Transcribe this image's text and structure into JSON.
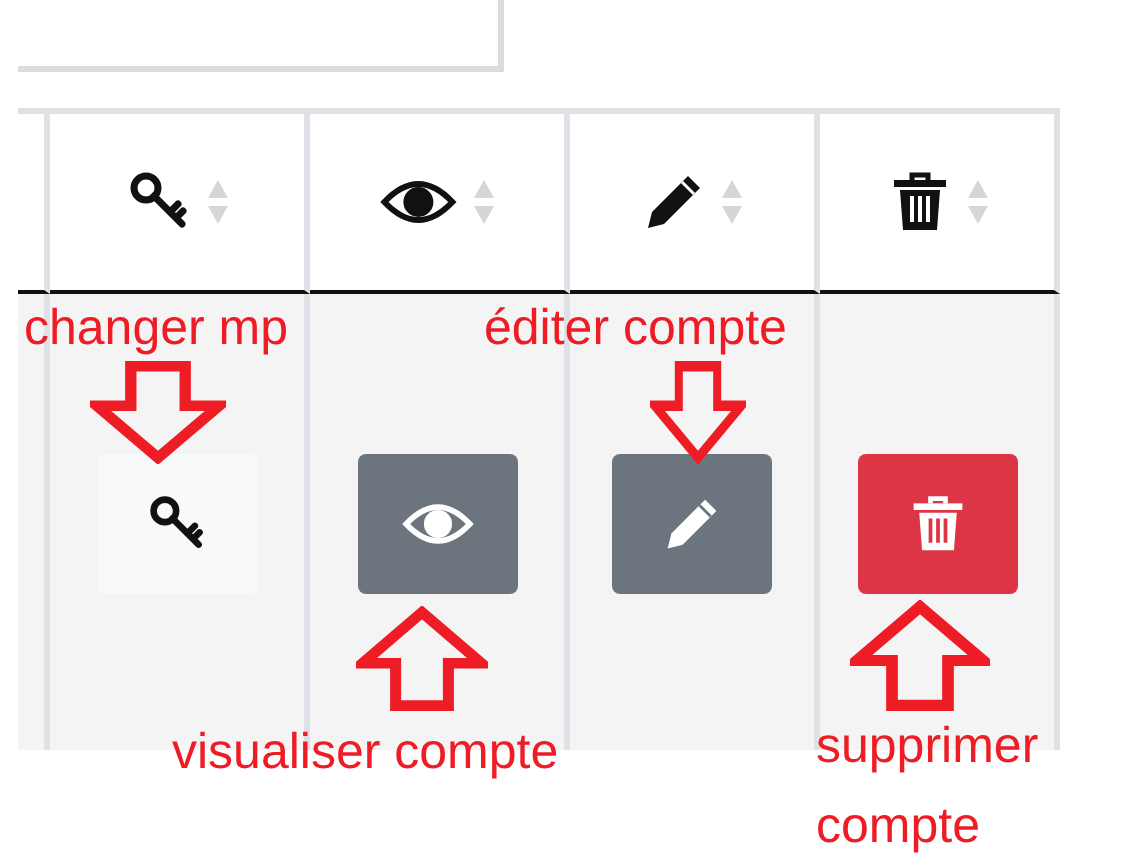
{
  "table": {
    "columns": [
      {
        "kind": "key"
      },
      {
        "kind": "eye"
      },
      {
        "kind": "pencil"
      },
      {
        "kind": "trash"
      }
    ],
    "rows": [
      {
        "actions": [
          {
            "kind": "key"
          },
          {
            "kind": "eye"
          },
          {
            "kind": "pencil"
          },
          {
            "kind": "trash"
          }
        ]
      }
    ]
  },
  "annotations": [
    {
      "text": "changer mp",
      "kind": "down"
    },
    {
      "text": "éditer compte",
      "kind": "down"
    },
    {
      "text": "visualiser compte",
      "kind": "up"
    },
    {
      "text": "supprimer compte",
      "kind": "up"
    }
  ]
}
